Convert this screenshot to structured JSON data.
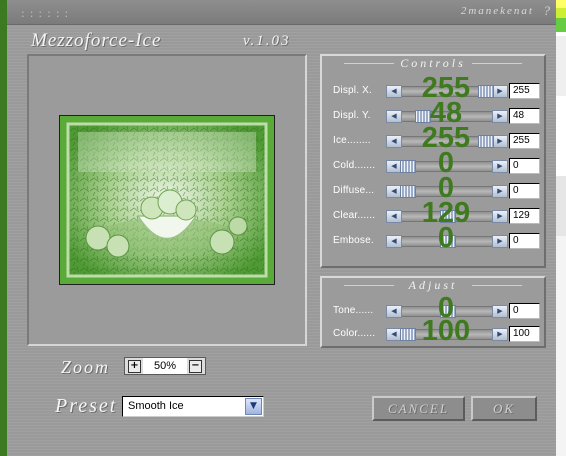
{
  "window": {
    "grip": "::::::",
    "author": "2manekenat",
    "help": "?",
    "app_title": "Mezzoforce-Ice",
    "version": "v.1.03"
  },
  "controls": {
    "title": "Controls",
    "sliders": [
      {
        "label": "Displ. X.",
        "value": "255",
        "position": 1.0
      },
      {
        "label": "Displ. Y.",
        "value": "48",
        "position": 0.19
      },
      {
        "label": "Ice........",
        "value": "255",
        "position": 1.0
      },
      {
        "label": "Cold.......",
        "value": "0",
        "position": 0.0
      },
      {
        "label": "Diffuse...",
        "value": "0",
        "position": 0.0
      },
      {
        "label": "Clear......",
        "value": "129",
        "position": 0.51
      },
      {
        "label": "Embose.",
        "value": "0",
        "position": 0.51
      }
    ]
  },
  "adjust": {
    "title": "Adjust",
    "sliders": [
      {
        "label": "Tone......",
        "value": "0",
        "position": 0.51
      },
      {
        "label": "Color......",
        "value": "100",
        "position": 0.0
      }
    ]
  },
  "zoom": {
    "label": "Zoom",
    "value": "50%",
    "plus": "+",
    "minus": "−"
  },
  "preset": {
    "label": "Preset",
    "value": "Smooth Ice"
  },
  "buttons": {
    "cancel": "CANCEL",
    "ok": "OK"
  },
  "colors": {
    "overlay_green": "#3f7a1f",
    "host_green": "#3c7a22"
  }
}
